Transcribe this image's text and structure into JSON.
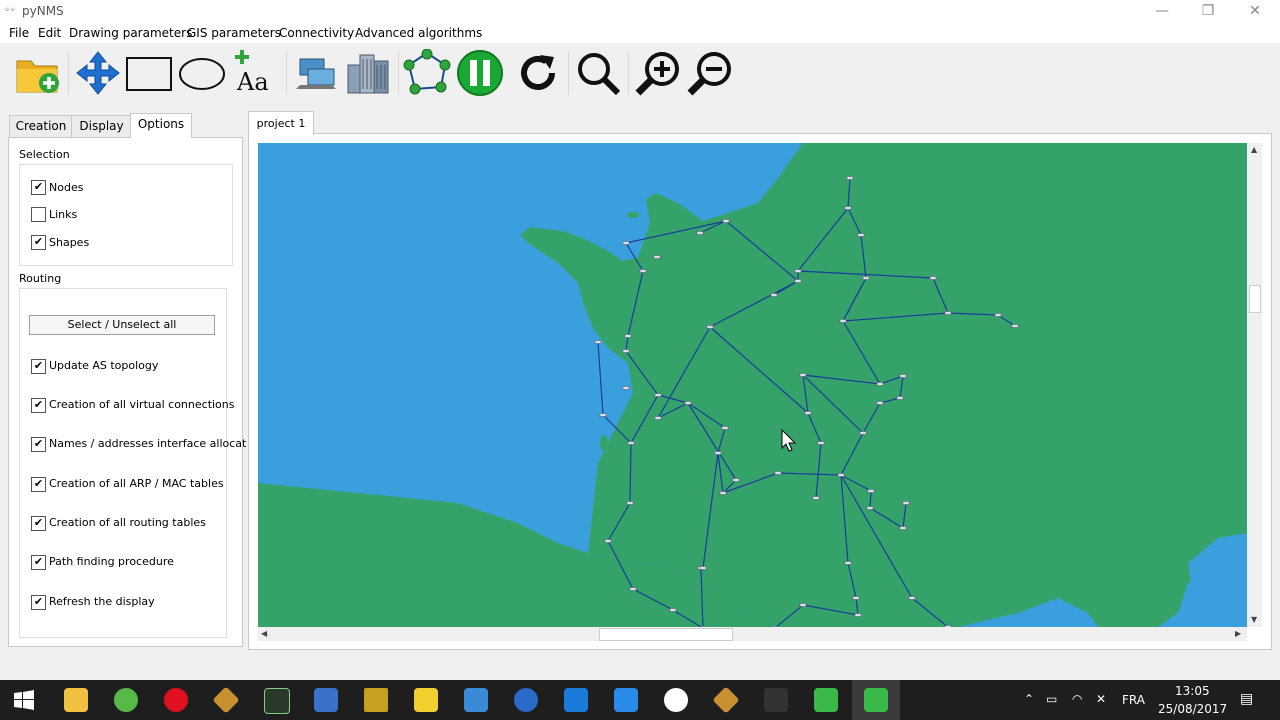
{
  "window": {
    "title": "pyNMS",
    "controls": {
      "minimize": "—",
      "restore": "❐",
      "close": "✕"
    }
  },
  "menu": {
    "items": [
      "File",
      "Edit",
      "Drawing parameters",
      "GIS parameters",
      "Connectivity",
      "Advanced algorithms"
    ]
  },
  "toolbar": {
    "icons": [
      "open-project-icon",
      "move-icon",
      "rectangle-icon",
      "ellipse-icon",
      "add-text-icon",
      "network-devices-icon",
      "buildings-icon",
      "graph-layout-icon",
      "pause-icon",
      "refresh-icon",
      "search-icon",
      "zoom-in-icon",
      "zoom-out-icon"
    ]
  },
  "left_panel": {
    "tabs": [
      "Creation",
      "Display",
      "Options"
    ],
    "active_tab": "Options",
    "selection": {
      "label": "Selection",
      "items": [
        {
          "label": "Nodes",
          "checked": true
        },
        {
          "label": "Links",
          "checked": false
        },
        {
          "label": "Shapes",
          "checked": true
        }
      ]
    },
    "routing": {
      "label": "Routing",
      "button": "Select / Unselect all",
      "items": [
        {
          "label": "Update AS topology",
          "checked": true
        },
        {
          "label": "Creation of all virtual connections",
          "checked": true
        },
        {
          "label": "Names / addresses interface allocat",
          "checked": true
        },
        {
          "label": "Creation of all ARP / MAC tables",
          "checked": true
        },
        {
          "label": "Creation of all routing tables",
          "checked": true
        },
        {
          "label": "Path finding procedure",
          "checked": true
        },
        {
          "label": "Refresh the display",
          "checked": true
        }
      ]
    }
  },
  "project": {
    "tab_label": "project 1"
  },
  "colors": {
    "sea": "#3aa0dd",
    "land": "#35a26a",
    "link": "#1a3c9c",
    "pause_green": "#1aa834"
  },
  "taskbar": {
    "language": "FRA",
    "time": "13:05",
    "date": "25/08/2017"
  }
}
